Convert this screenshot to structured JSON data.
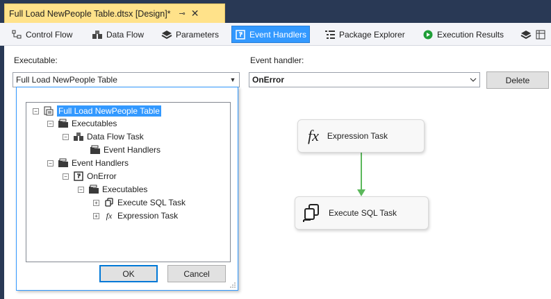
{
  "document_tab": {
    "title": "Full Load NewPeople Table.dtsx [Design]*",
    "pin": "⊸",
    "close": "✕"
  },
  "designer_tabs": [
    {
      "label": "Control Flow",
      "icon": "control-flow-icon"
    },
    {
      "label": "Data Flow",
      "icon": "data-flow-icon"
    },
    {
      "label": "Parameters",
      "icon": "parameters-icon"
    },
    {
      "label": "Event Handlers",
      "icon": "event-handlers-icon",
      "active": true
    },
    {
      "label": "Package Explorer",
      "icon": "package-explorer-icon"
    },
    {
      "label": "Execution Results",
      "icon": "execution-results-icon"
    }
  ],
  "executable": {
    "label": "Executable:",
    "value": "Full Load NewPeople Table"
  },
  "event_handler": {
    "label": "Event handler:",
    "value": "OnError"
  },
  "delete_button": "Delete",
  "tree": {
    "root": "Full Load NewPeople Table",
    "executables": "Executables",
    "data_flow_task": "Data Flow Task",
    "dft_event_handlers": "Event Handlers",
    "event_handlers": "Event Handlers",
    "on_error": "OnError",
    "on_error_executables": "Executables",
    "execute_sql_task": "Execute SQL Task",
    "expression_task": "Expression Task"
  },
  "popup_buttons": {
    "ok": "OK",
    "cancel": "Cancel"
  },
  "canvas": {
    "expression_task": {
      "label": "Expression Task",
      "icon_text": "fx"
    },
    "execute_sql_task": {
      "label": "Execute SQL Task"
    },
    "connector_color": "#5cb85c"
  }
}
